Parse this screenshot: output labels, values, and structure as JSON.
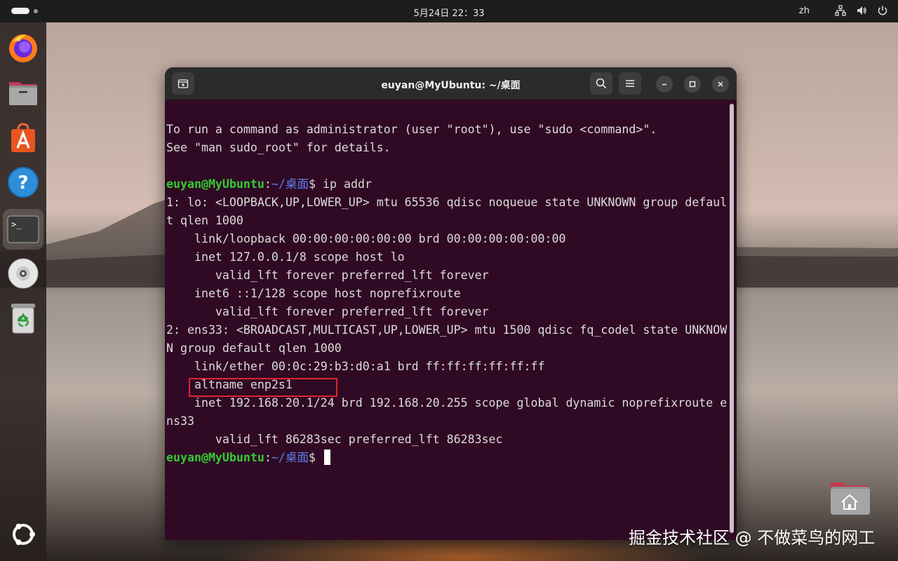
{
  "topbar": {
    "clock": "5月24日  22：33",
    "language": "zh"
  },
  "dock": {
    "items": [
      {
        "icon": "firefox-icon"
      },
      {
        "icon": "files-icon"
      },
      {
        "icon": "app-center-icon"
      },
      {
        "icon": "help-icon"
      },
      {
        "icon": "terminal-icon"
      },
      {
        "icon": "disc-icon"
      },
      {
        "icon": "trash-icon"
      },
      {
        "icon": "ubuntu-logo-icon"
      }
    ]
  },
  "window": {
    "title": "euyan@MyUbuntu: ~/桌面"
  },
  "terminal": {
    "user_host": "euyan@MyUbuntu",
    "path": "~/桌面",
    "lines": [
      "To run a command as administrator (user \"root\"), use \"sudo <command>\".",
      "See \"man sudo_root\" for details.",
      "",
      " ip addr",
      "1: lo: <LOOPBACK,UP,LOWER_UP> mtu 65536 qdisc noqueue state UNKNOWN group defaul",
      "t qlen 1000",
      "    link/loopback 00:00:00:00:00:00 brd 00:00:00:00:00:00",
      "    inet 127.0.0.1/8 scope host lo",
      "       valid_lft forever preferred_lft forever",
      "    inet6 ::1/128 scope host noprefixroute",
      "       valid_lft forever preferred_lft forever",
      "2: ens33: <BROADCAST,MULTICAST,UP,LOWER_UP> mtu 1500 qdisc fq_codel state UNKNOW",
      "N group default qlen 1000",
      "    link/ether 00:0c:29:b3:d0:a1 brd ff:ff:ff:ff:ff:ff",
      "    altname enp2s1",
      "    inet 192.168.20.1/24 brd 192.168.20.255 scope global dynamic noprefixroute e",
      "ns33",
      "       valid_lft 86283sec preferred_lft 86283sec",
      " "
    ],
    "highlight_text": "inet 192.168.20.1/24",
    "highlight_color": "#e0252b"
  },
  "watermark": "掘金技术社区 @ 不做菜鸟的网工"
}
